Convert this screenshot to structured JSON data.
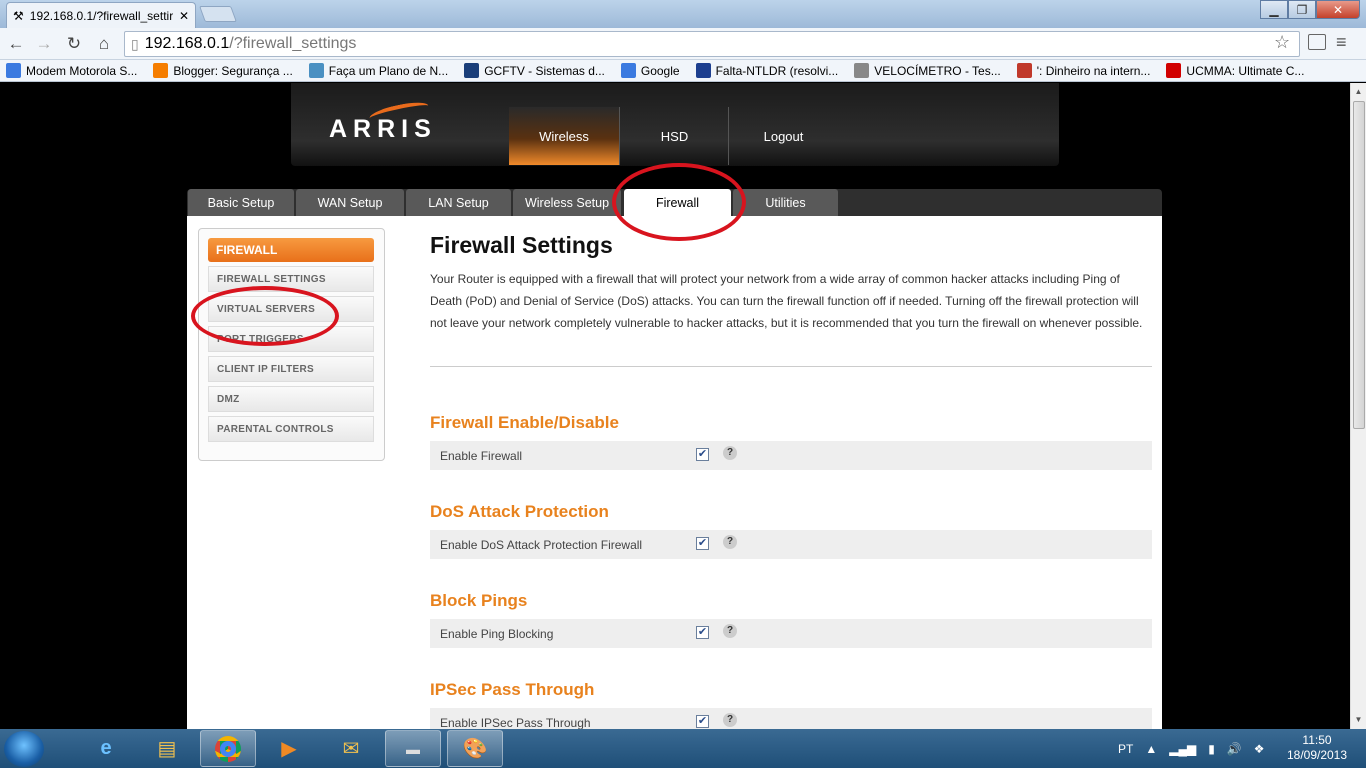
{
  "browser": {
    "tab_title": "192.168.0.1/?firewall_settir",
    "url_host": "192.168.0.1",
    "url_path": "/?firewall_settings",
    "bookmarks": [
      {
        "label": "Modem Motorola S...",
        "color": "#3b7ae0"
      },
      {
        "label": "Blogger: Segurança ...",
        "color": "#f57d00"
      },
      {
        "label": "Faça um Plano de N...",
        "color": "#4a90c2"
      },
      {
        "label": "GCFTV - Sistemas d...",
        "color": "#1b3f7a"
      },
      {
        "label": "Google",
        "color": "#3b7ae0"
      },
      {
        "label": "Falta-NTLDR (resolvi...",
        "color": "#1d3f8f"
      },
      {
        "label": "VELOCÍMETRO - Tes...",
        "color": "#888888"
      },
      {
        "label": "': Dinheiro na intern...",
        "color": "#c0392b"
      },
      {
        "label": "UCMMA: Ultimate C...",
        "color": "#d10000"
      }
    ]
  },
  "header": {
    "logo": "ARRIS",
    "nav": [
      "Wireless",
      "HSD",
      "Logout"
    ]
  },
  "tabs": [
    "Basic Setup",
    "WAN Setup",
    "LAN Setup",
    "Wireless Setup",
    "Firewall",
    "Utilities"
  ],
  "sidebar": {
    "heading": "FIREWALL",
    "items": [
      "FIREWALL SETTINGS",
      "VIRTUAL SERVERS",
      "PORT TRIGGERS",
      "CLIENT IP FILTERS",
      "DMZ",
      "PARENTAL CONTROLS"
    ]
  },
  "main": {
    "title": "Firewall Settings",
    "description": "Your Router is equipped with a firewall that will protect your network from a wide array of common hacker attacks including Ping of Death (PoD) and Denial of Service (DoS) attacks. You can turn the firewall function off if needed. Turning off the firewall protection will not leave your network completely vulnerable to hacker attacks, but it is recommended that you turn the firewall on whenever possible.",
    "sections": [
      {
        "heading": "Firewall Enable/Disable",
        "label": "Enable Firewall",
        "checked": true
      },
      {
        "heading": "DoS Attack Protection",
        "label": "Enable DoS Attack Protection Firewall",
        "checked": true
      },
      {
        "heading": "Block Pings",
        "label": "Enable Ping Blocking",
        "checked": true
      },
      {
        "heading": "IPSec Pass Through",
        "label": "Enable IPSec Pass Through",
        "checked": true
      }
    ],
    "help_glyph": "?",
    "check_glyph": "✔"
  },
  "taskbar": {
    "language": "PT",
    "time": "11:50",
    "date": "18/09/2013"
  },
  "colors": {
    "accent": "#e8821e",
    "annotation": "#d8141e"
  }
}
